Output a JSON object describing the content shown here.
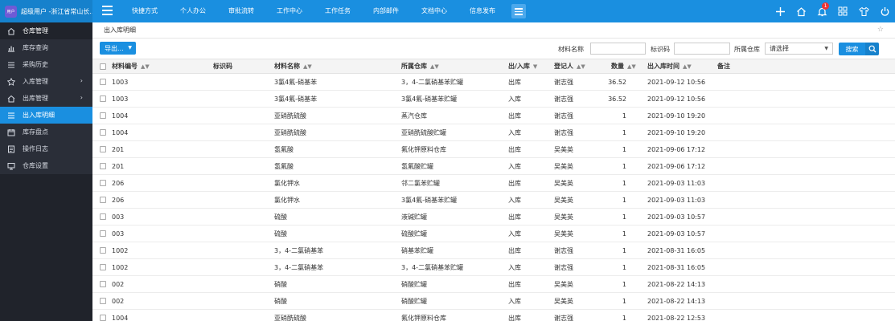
{
  "brand": {
    "avatar_text": "用户",
    "title": "超级用户 -浙江省常山长..."
  },
  "topnav": [
    "快捷方式",
    "个人办公",
    "审批流转",
    "工作中心",
    "工作任务",
    "内部邮件",
    "文档中心",
    "信息发布"
  ],
  "top_icons": [
    "plus-icon",
    "home-icon",
    "bell-icon",
    "apps-icon",
    "shirt-icon",
    "power-icon"
  ],
  "notification_count": "1",
  "sidebar": {
    "items": [
      {
        "label": "仓库管理",
        "icon": "home-icon"
      },
      {
        "label": "库存查询",
        "icon": "chart-icon"
      },
      {
        "label": "采购历史",
        "icon": "list-icon"
      },
      {
        "label": "入库管理",
        "icon": "star-icon",
        "arrow": "›"
      },
      {
        "label": "出库管理",
        "icon": "home-icon",
        "arrow": "›"
      },
      {
        "label": "出入库明细",
        "icon": "list-icon"
      },
      {
        "label": "库存盘点",
        "icon": "calendar-icon"
      },
      {
        "label": "操作日志",
        "icon": "log-icon"
      },
      {
        "label": "仓库设置",
        "icon": "desktop-icon"
      }
    ]
  },
  "breadcrumb": "出入库明细",
  "toolbar": {
    "export_label": "导出...",
    "material_name_label": "材料名称",
    "material_name_value": "",
    "id_code_label": "标识码",
    "id_code_value": "",
    "warehouse_label": "所属仓库",
    "warehouse_value": "请选择",
    "search_label": "搜索"
  },
  "table": {
    "headers": {
      "code": "材料编号",
      "idcode": "标识码",
      "name": "材料名称",
      "warehouse": "所属仓库",
      "direction": "出/入库",
      "registrar": "登记人",
      "qty": "数量",
      "time": "出入库时间",
      "note": "备注"
    },
    "rows": [
      [
        "1003",
        "",
        "3氯4氟-硝基苯",
        "3，4-二氯硝基苯贮罐",
        "出库",
        "谢志强",
        "36.52",
        "2021-09-12 10:56",
        ""
      ],
      [
        "1003",
        "",
        "3氯4氟-硝基苯",
        "3氯4氟-硝基苯贮罐",
        "入库",
        "谢志强",
        "36.52",
        "2021-09-12 10:56",
        ""
      ],
      [
        "1004",
        "",
        "亚硝酰硫酸",
        "蒸汽仓库",
        "出库",
        "谢志强",
        "1",
        "2021-09-10 19:20",
        ""
      ],
      [
        "1004",
        "",
        "亚硝酰硫酸",
        "亚硝酰硫酸贮罐",
        "入库",
        "谢志强",
        "1",
        "2021-09-10 19:20",
        ""
      ],
      [
        "201",
        "",
        "氢氟酸",
        "氟化钾原料仓库",
        "出库",
        "吴美英",
        "1",
        "2021-09-06 17:12",
        ""
      ],
      [
        "201",
        "",
        "氢氟酸",
        "氢氟酸贮罐",
        "入库",
        "吴美英",
        "1",
        "2021-09-06 17:12",
        ""
      ],
      [
        "206",
        "",
        "氯化钾水",
        "邻二氯苯贮罐",
        "出库",
        "吴美英",
        "1",
        "2021-09-03 11:03",
        ""
      ],
      [
        "206",
        "",
        "氯化钾水",
        "3氯4氟-硝基苯贮罐",
        "入库",
        "吴美英",
        "1",
        "2021-09-03 11:03",
        ""
      ],
      [
        "003",
        "",
        "硫酸",
        "液碱贮罐",
        "出库",
        "吴美英",
        "1",
        "2021-09-03 10:57",
        ""
      ],
      [
        "003",
        "",
        "硫酸",
        "硫酸贮罐",
        "入库",
        "吴美英",
        "1",
        "2021-09-03 10:57",
        ""
      ],
      [
        "1002",
        "",
        "3，4-二氯硝基苯",
        "硝基苯贮罐",
        "出库",
        "谢志强",
        "1",
        "2021-08-31 16:05",
        ""
      ],
      [
        "1002",
        "",
        "3，4-二氯硝基苯",
        "3，4-二氯硝基苯贮罐",
        "入库",
        "谢志强",
        "1",
        "2021-08-31 16:05",
        ""
      ],
      [
        "002",
        "",
        "硝酸",
        "硝酸贮罐",
        "出库",
        "吴美英",
        "1",
        "2021-08-22 14:13",
        ""
      ],
      [
        "002",
        "",
        "硝酸",
        "硝酸贮罐",
        "入库",
        "吴美英",
        "1",
        "2021-08-22 14:13",
        ""
      ],
      [
        "1004",
        "",
        "亚硝酰硫酸",
        "氟化钾原料仓库",
        "出库",
        "谢志强",
        "1",
        "2021-08-22 12:53",
        ""
      ]
    ]
  },
  "colors": {
    "accent": "#1a8fe0",
    "sidebar_bg": "#20232b",
    "active": "#1a8fe0"
  }
}
